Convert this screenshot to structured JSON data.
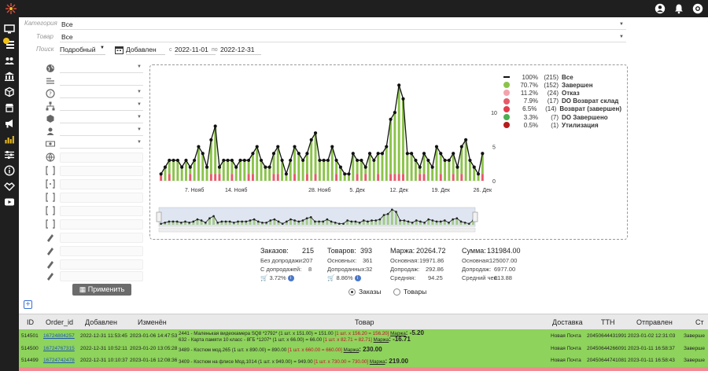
{
  "topbar": {
    "icons": [
      "user-icon",
      "bell-icon",
      "support-icon"
    ]
  },
  "rail": {
    "icons": [
      "monitor-icon",
      "list-icon",
      "users-icon",
      "bank-icon",
      "box-icon",
      "warehouse-icon",
      "megaphone-icon",
      "chart-icon",
      "sliders-icon",
      "info-icon",
      "handshake-icon",
      "play-icon"
    ]
  },
  "filters": {
    "category_label": "Категория",
    "category_value": "Все",
    "goods_label": "Товар",
    "goods_value": "Все",
    "search_label": "Поиск",
    "mode_value": "Подробный",
    "date_type_value": "Добавлен",
    "from_label": "с",
    "from_value": "2022-11-01",
    "to_label": "по",
    "to_value": "2022-12-31"
  },
  "apply_label": "Применить",
  "legend": [
    {
      "pct": "100%",
      "cnt": "(215)",
      "name": "Все",
      "color": "#111111"
    },
    {
      "pct": "70.7%",
      "cnt": "(152)",
      "name": "Завершен",
      "color": "#8bc34a"
    },
    {
      "pct": "11.2%",
      "cnt": "(24)",
      "name": "Отказ",
      "color": "#f4a3ad"
    },
    {
      "pct": "7.9%",
      "cnt": "(17)",
      "name": "DO Возврат склад",
      "color": "#e75a6a"
    },
    {
      "pct": "6.5%",
      "cnt": "(14)",
      "name": "Возврат (завершен)",
      "color": "#e53b4d"
    },
    {
      "pct": "3.3%",
      "cnt": "(7)",
      "name": "DO Завершено",
      "color": "#4caf50"
    },
    {
      "pct": "0.5%",
      "cnt": "(1)",
      "name": "Утилизация",
      "color": "#b71c1c"
    }
  ],
  "chart_data": {
    "type": "bar",
    "x_labels": [
      "7. Нояб",
      "14. Нояб",
      "28. Нояб",
      "5. Дек",
      "12. Дек",
      "19. Дек",
      "26. Дек"
    ],
    "y_ticks": [
      0,
      5,
      10
    ],
    "ylim": [
      0,
      14.5
    ],
    "totals": [
      1,
      2,
      3,
      3,
      3,
      2,
      3,
      2,
      3,
      5,
      4,
      2,
      6,
      8,
      2,
      3,
      3,
      3,
      2,
      3,
      3,
      3,
      4,
      5,
      3,
      2,
      2,
      4,
      5,
      3,
      1,
      3,
      5,
      4,
      3,
      4,
      6,
      7,
      3,
      3,
      3,
      5,
      3,
      2,
      1,
      1,
      4,
      3,
      3,
      2,
      4,
      3,
      4,
      4,
      5,
      9,
      10,
      14,
      12,
      4,
      4,
      3,
      2,
      4,
      3,
      2,
      5,
      4,
      3,
      3,
      4,
      2,
      5,
      6,
      3,
      2,
      1,
      4
    ],
    "series_colors": [
      "#8bc34a",
      "#e75a6a"
    ],
    "series_names": [
      "Завершен",
      "Отказ/Возврат"
    ]
  },
  "stats": {
    "orders_label": "Заказов:",
    "orders_value": "215",
    "no_upsell_label": "Без допродажи:",
    "no_upsell_value": "207",
    "with_upsell_label": "С допродажей:",
    "with_upsell_value": "8",
    "orders_pct": "3.72%",
    "goods_label": "Товаров:",
    "goods_value": "393",
    "main_label": "Основных:",
    "main_value": "361",
    "upsold_label": "Допроданных:",
    "upsold_value": "32",
    "goods_pct": "8.86%",
    "margin_label": "Маржа:",
    "margin_value": "20264.72",
    "margin_main_label": "Основная:",
    "margin_main_value": "19971.86",
    "margin_up_label": "Допродаж:",
    "margin_up_value": "292.86",
    "margin_avg_label": "Средняя:",
    "margin_avg_value": "94.25",
    "sum_label": "Сумма:",
    "sum_value": "131984.00",
    "sum_main_label": "Основная:",
    "sum_main_value": "125007.00",
    "sum_up_label": "Допродаж:",
    "sum_up_value": "6977.00",
    "avg_check_label": "Средний чек:",
    "avg_check_value": "613.88"
  },
  "radio": {
    "orders": "Заказы",
    "goods": "Товары"
  },
  "table": {
    "headers": [
      "ID",
      "Order_id",
      "Добавлен",
      "Изменён",
      "Товар",
      "Доставка",
      "ТТН",
      "Отправлен",
      "Ст"
    ],
    "rows": [
      {
        "id": "514501",
        "order_id": "16724804257",
        "added": "2022-12-31 11:53:45",
        "changed": "2023-01-06 14:47:53",
        "goods1_pre": "2441 - Маленькая видеокамера SQ8 *2792* (1 шт. x 151.00) = 151.00 ",
        "goods1_red": "[1 шт. x 156.20 = 156.20]",
        "goods1_marg": "Маржа",
        "goods1_mval": ": -5.20",
        "goods2_pre": "632 - Карта памяти 10 класс - 8ГБ *1207* (1 шт. x 66.00) = 66.00 ",
        "goods2_red": "[1 шт. x 82.71 = 82.71]",
        "goods2_marg": "Маржа",
        "goods2_mval": ": -16.71",
        "delivery": "Новая Почта",
        "ttn": "20450644431991",
        "sent": "2023-01-02 12:31:03",
        "status": "Заверше",
        "color": "#8ed35c"
      },
      {
        "id": "514500",
        "order_id": "16724767315",
        "added": "2022-12-31 10:52:11",
        "changed": "2023-01-20 13:05:28",
        "goods1_pre": "3489 - Костюм мод.265 (1 шт. x 890.00) = 890.00 ",
        "goods1_red": "[1 шт. x 660.00 = 660.00]",
        "goods1_marg": "Маржа",
        "goods1_mval": ": 230.00",
        "delivery": "Новая Почта",
        "ttn": "20450644266091",
        "sent": "2023-01-11 16:58:37",
        "status": "Заверше",
        "color": "#8ed35c"
      },
      {
        "id": "514499",
        "order_id": "16724742478",
        "added": "2022-12-31 10:10:37",
        "changed": "2023-01-16 12:08:36",
        "goods1_pre": "3409 - Костюм на флисе Мод.1014 (1 шт. x 949.00) = 949.00 ",
        "goods1_red": "[1 шт. x 730.00 = 730.00]",
        "goods1_marg": "Маржа",
        "goods1_mval": ": 219.00",
        "delivery": "Новая Почта",
        "ttn": "20450644741081",
        "sent": "2023-01-11 16:58:43",
        "status": "Заверше",
        "color": "#8ed35c"
      },
      {
        "color": "#f28a94"
      }
    ]
  }
}
